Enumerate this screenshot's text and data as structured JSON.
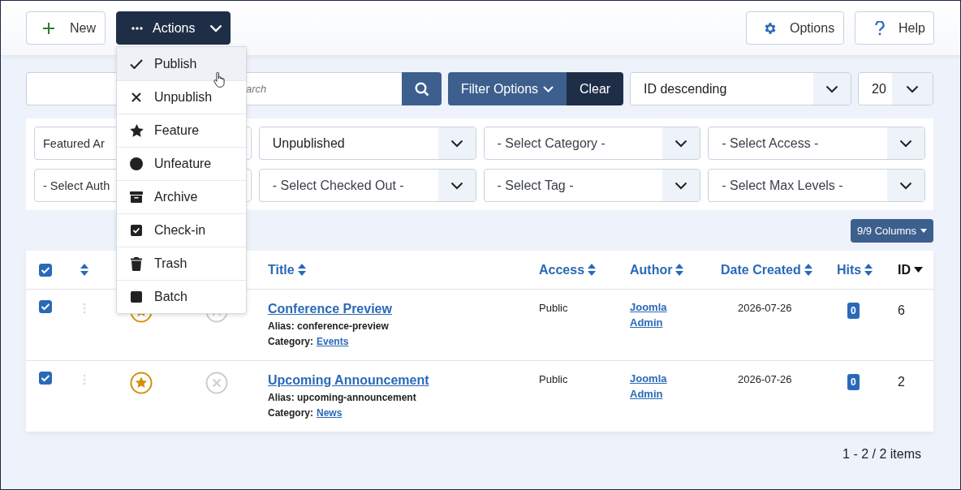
{
  "toolbar": {
    "buttons": [
      {
        "label": "New",
        "kind": "new"
      },
      {
        "label": "Actions",
        "kind": "actions"
      },
      {
        "label": "Options",
        "kind": "options"
      },
      {
        "label": "Help",
        "kind": "help"
      }
    ]
  },
  "actions_menu": {
    "items": [
      {
        "label": "Publish",
        "kind": "check",
        "highlighted": true
      },
      {
        "label": "Unpublish",
        "kind": "cross",
        "highlighted": false
      },
      {
        "label": "Feature",
        "kind": "star",
        "highlighted": false
      },
      {
        "label": "Unfeature",
        "kind": "circle",
        "highlighted": false
      },
      {
        "label": "Archive",
        "kind": "archive",
        "highlighted": false
      },
      {
        "label": "Check-in",
        "kind": "checkbox",
        "highlighted": false
      },
      {
        "label": "Trash",
        "kind": "trash",
        "highlighted": false
      },
      {
        "label": "Batch",
        "kind": "square",
        "highlighted": false
      }
    ]
  },
  "search": {
    "placeholder": "arch",
    "filter_options": "Filter Options",
    "clear": "Clear"
  },
  "ordering": {
    "value": "ID descending"
  },
  "limit": {
    "value": "20"
  },
  "filters": [
    {
      "value": "Featured Ar",
      "kind": "cut"
    },
    {
      "value": "Unpublished",
      "kind": "select"
    },
    {
      "value": "- Select Category -",
      "kind": "select"
    },
    {
      "value": "- Select Access -",
      "kind": "select"
    },
    {
      "value": "- Select Auth",
      "kind": "cut"
    },
    {
      "value": "- Select Checked Out -",
      "kind": "select"
    },
    {
      "value": "- Select Tag -",
      "kind": "select"
    },
    {
      "value": "- Select Max Levels -",
      "kind": "select"
    }
  ],
  "columns_button": "9/9 Columns",
  "table": {
    "all_checked": true,
    "columns": [
      {
        "label": "Title",
        "kind": "both"
      },
      {
        "label": "Access",
        "kind": "both"
      },
      {
        "label": "Author",
        "kind": "both"
      },
      {
        "label": "Date Created",
        "kind": "both"
      },
      {
        "label": "Hits",
        "kind": "both"
      },
      {
        "label": "ID",
        "kind": "desc"
      }
    ],
    "rows": [
      {
        "checked": true,
        "featured": true,
        "published": false,
        "title": "Conference Preview",
        "alias": "Alias: conference-preview",
        "category_label": "Category:",
        "category": "Events",
        "access": "Public",
        "author": "Joomla Admin",
        "date": "2026-07-26",
        "hits": "0",
        "id": "6"
      },
      {
        "checked": true,
        "featured": true,
        "published": false,
        "title": "Upcoming Announcement",
        "alias": "Alias: upcoming-announcement",
        "category_label": "Category:",
        "category": "News",
        "access": "Public",
        "author": "Joomla Admin",
        "date": "2026-07-26",
        "hits": "0",
        "id": "2"
      }
    ]
  },
  "pagination": "1 - 2 / 2 items"
}
